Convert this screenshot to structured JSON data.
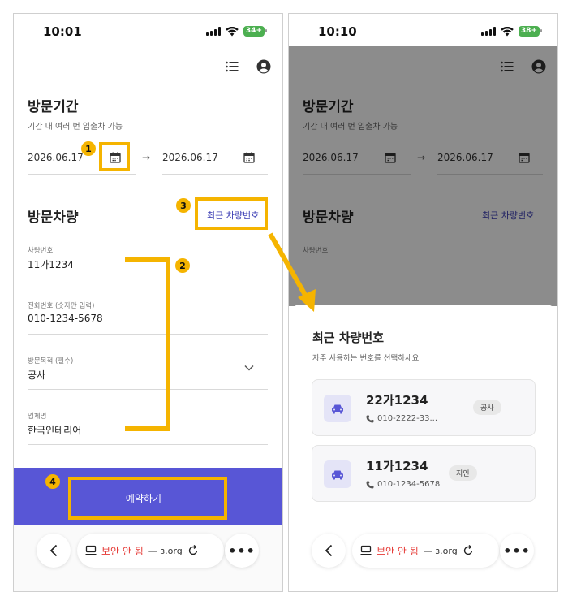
{
  "left": {
    "status": {
      "time": "10:01",
      "battery": "34+"
    },
    "visit_period": {
      "title": "방문기간",
      "subtitle": "기간 내 여러 번 입출차 가능",
      "start_date": "2026.06.17",
      "end_date": "2026.06.17",
      "arrow": "→"
    },
    "visit_vehicle": {
      "title": "방문차량",
      "recent_link": "최근 차량번호",
      "fields": [
        {
          "label": "차량번호",
          "value": "11가1234"
        },
        {
          "label": "전화번호 (숫자만 입력)",
          "value": "010-1234-5678"
        },
        {
          "label": "방문목적 (필수)",
          "value": "공사"
        },
        {
          "label": "업체명",
          "value": "한국인테리어"
        }
      ]
    },
    "book_button": "예약하기",
    "browser": {
      "warning": "보안 안 됨",
      "domain": "— ɜ.org"
    }
  },
  "right": {
    "status": {
      "time": "10:10",
      "battery": "38+"
    },
    "visit_period": {
      "title": "방문기간",
      "subtitle": "기간 내 여러 번 입출차 가능",
      "start_date": "2026.06.17",
      "end_date": "2026.06.17",
      "arrow": "→"
    },
    "visit_vehicle": {
      "title": "방문차량",
      "recent_link": "최근 차량번호",
      "first_label": "차량번호"
    },
    "sheet": {
      "title": "최근 차량번호",
      "subtitle": "자주 사용하는 번호를 선택하세요",
      "items": [
        {
          "plate": "22가1234",
          "phone": "010-2222-33...",
          "tag": "공사"
        },
        {
          "plate": "11가1234",
          "phone": "010-1234-5678",
          "tag": "지인"
        }
      ]
    },
    "browser": {
      "warning": "보안 안 됨",
      "domain": "— ɜ.org"
    }
  },
  "annotations": [
    "1",
    "2",
    "3",
    "4"
  ],
  "colors": {
    "accent": "#5856d6",
    "link": "#3d3fb5",
    "highlight": "#f5b400",
    "warning": "#e53935"
  }
}
